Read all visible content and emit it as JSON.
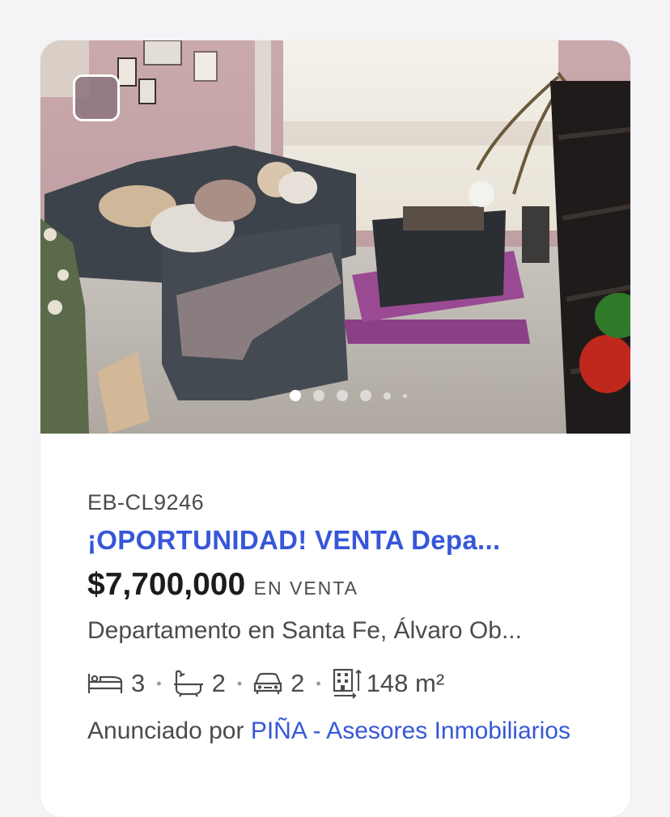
{
  "listing": {
    "code": "EB-CL9246",
    "title": "¡OPORTUNIDAD! VENTA Depa...",
    "price": "$7,700,000",
    "operation": "EN VENTA",
    "address": "Departamento en Santa Fe, Álvaro Ob...",
    "features": {
      "bedrooms": "3",
      "bathrooms": "2",
      "parking": "2",
      "area": "148 m²"
    },
    "advertiser_prefix": "Anunciado por ",
    "advertiser_name": "PIÑA - Asesores Inmobiliarios"
  },
  "gallery": {
    "photo_count": 6,
    "active_index": 0
  },
  "colors": {
    "accent": "#3757d8",
    "text": "#4b4b4f",
    "price": "#1c1c20"
  }
}
